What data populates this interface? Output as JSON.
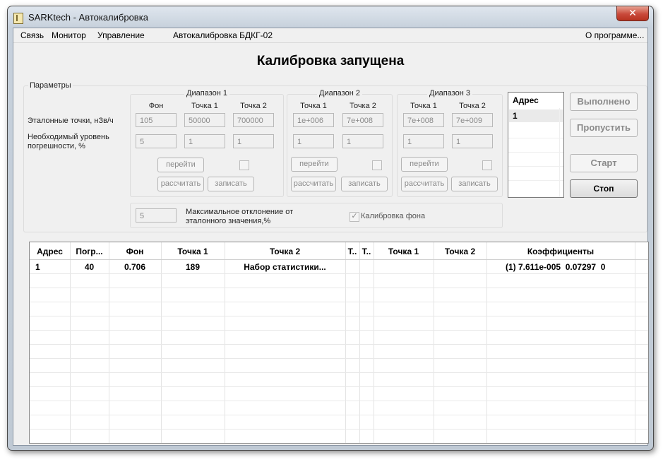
{
  "window": {
    "title": "SARKtech - Автокалибровка",
    "close_glyph": "✕"
  },
  "menu": {
    "items": [
      "Связь",
      "Монитор",
      "Управление"
    ],
    "mode_label": "Автокалибровка БДКГ-02",
    "about": "О программе..."
  },
  "status_title": "Калибровка запущена",
  "params": {
    "group_label": "Параметры",
    "row_labels": {
      "reference": "Эталонные точки, нЗв/ч",
      "error_line1": "Необходимый уровень",
      "error_line2": "погрешности, %"
    },
    "ranges": [
      {
        "title": "Диапазон 1",
        "columns": [
          "Фон",
          "Точка 1",
          "Точка 2"
        ],
        "reference": [
          "105",
          "50000",
          "700000"
        ],
        "error": [
          "5",
          "1",
          "1"
        ]
      },
      {
        "title": "Диапазон 2",
        "columns": [
          "Точка 1",
          "Точка 2"
        ],
        "reference": [
          "1e+006",
          "7e+008"
        ],
        "error": [
          "1",
          "1"
        ]
      },
      {
        "title": "Диапазон 3",
        "columns": [
          "Точка 1",
          "Точка 2"
        ],
        "reference": [
          "7e+008",
          "7e+009"
        ],
        "error": [
          "1",
          "1"
        ]
      }
    ],
    "buttons": {
      "goto": "перейти",
      "calculate": "рассчитать",
      "write": "записать"
    },
    "max_deviation": {
      "value": "5",
      "label_line1": "Максимальное отклонение от",
      "label_line2": "эталонного значения,%"
    },
    "background_calibration": {
      "label": "Калибровка фона",
      "checked": true
    }
  },
  "address_list": {
    "header": "Адрес",
    "items": [
      "1"
    ]
  },
  "side_buttons": {
    "done": "Выполнено",
    "skip": "Пропустить",
    "start": "Старт",
    "stop": "Стоп"
  },
  "table": {
    "columns": [
      "Адрес",
      "Погр...",
      "Фон",
      "Точка 1",
      "Точка 2",
      "Т..",
      "Т..",
      "Точка 1",
      "Точка 2",
      "Коэффициенты"
    ],
    "rows": [
      [
        "1",
        "40",
        "0.706",
        "189",
        "Набор статистики...",
        "",
        "",
        "",
        "",
        "(1) 7.611e-005  0.07297  0"
      ]
    ]
  },
  "colors": {
    "accent_close": "#c9493a",
    "window_frame": "#bfc9d4"
  }
}
